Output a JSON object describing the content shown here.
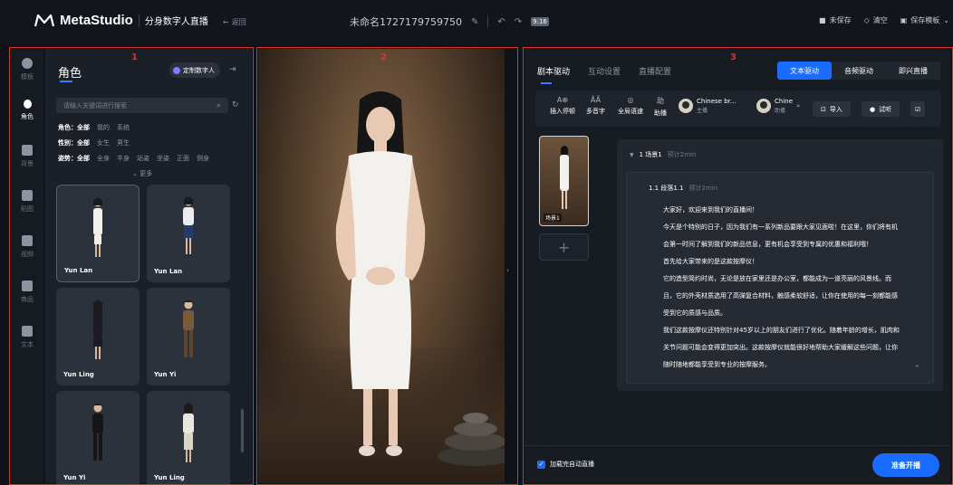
{
  "header": {
    "logo_text": "MetaStudio",
    "sub_title": "分身数字人直播",
    "back_label": "返回",
    "project_name": "未命名1727179759750",
    "ratio_badge": "9:16",
    "unsaved": "未保存",
    "clear": "清空",
    "save_template": "保存模板"
  },
  "panel_numbers": [
    "1",
    "2",
    "3"
  ],
  "rail": {
    "items": [
      {
        "label": "模板",
        "icon": "template-icon"
      },
      {
        "label": "角色",
        "icon": "person-icon"
      },
      {
        "label": "背景",
        "icon": "background-icon"
      },
      {
        "label": "贴图",
        "icon": "sticker-icon"
      },
      {
        "label": "视频",
        "icon": "video-icon"
      },
      {
        "label": "商品",
        "icon": "product-icon"
      },
      {
        "label": "文本",
        "icon": "text-icon"
      }
    ],
    "active_index": 1
  },
  "role_panel": {
    "title": "角色",
    "custom_btn": "定制数字人",
    "search_placeholder": "请输入关键词进行搜索",
    "filters": [
      {
        "label": "角色：",
        "options": [
          "全部",
          "我的",
          "系统"
        ]
      },
      {
        "label": "性别：",
        "options": [
          "全部",
          "女生",
          "男生"
        ]
      },
      {
        "label": "姿势：",
        "options": [
          "全部",
          "全身",
          "半身",
          "站姿",
          "坐姿",
          "正面",
          "侧身"
        ]
      }
    ],
    "more": "更多",
    "cards": [
      {
        "name": "Yun Lan",
        "outfit": "#f2efe9",
        "skirt": "#f2efe9"
      },
      {
        "name": "Yun Lan",
        "outfit": "#e9ecf2",
        "skirt": "#233c6b"
      },
      {
        "name": "Yun Ling",
        "outfit": "#1b1b24",
        "skirt": "#1b1b24"
      },
      {
        "name": "Yun Yi",
        "outfit": "#7a5a3a",
        "skirt": "#5c4630"
      },
      {
        "name": "Yun Yi",
        "outfit": "#161616",
        "skirt": "#161616"
      },
      {
        "name": "Yun Ling",
        "outfit": "#ebe6dc",
        "skirt": "#d9d3c6"
      }
    ]
  },
  "script_panel": {
    "tabs": [
      "剧本驱动",
      "互动设置",
      "直播配置"
    ],
    "drive_tabs": [
      "文本驱动",
      "音频驱动",
      "即兴直播"
    ],
    "tools": [
      {
        "glyph": "A⊕",
        "label": "插入停顿"
      },
      {
        "glyph": "ÃÃ",
        "label": "多音字"
      },
      {
        "glyph": "◎",
        "label": "全局语速"
      },
      {
        "glyph": "助",
        "label": "助播"
      }
    ],
    "voices": [
      {
        "name": "Chinese br...",
        "role": "主播"
      },
      {
        "name": "Chine",
        "role": "助播"
      }
    ],
    "import": "导入",
    "listen": "试听",
    "scene_thumb_label": "场景1",
    "scene_title": "1  场景1",
    "scene_estimate": "预计2min",
    "para_title": "1.1  段落1.1",
    "para_estimate": "预计2min",
    "lines": [
      "大家好，欢迎来到我们的直播间！",
      "今天是个特别的日子，因为我们有一系列新品要跟大家见面啦！在这里，你们将有机",
      "会第一时间了解到我们的新品信息，更有机会享受到专属的优惠和福利哦！",
      "首先给大家带来的是这款按摩仪！",
      "它的造型简约时尚，无论是放在家里还是办公室，都能成为一道亮丽的风景线。而",
      "且，它的外壳材质选用了高弹复合材料，触感柔软舒适，让你在使用的每一刻都能感",
      "受到它的质感与品质。",
      "我们这款按摩仪还特别针对45岁以上的朋友们进行了优化。随着年龄的增长，肌肉和",
      "关节问题可能会变得更加突出。这款按摩仪就能很好地帮助大家缓解这些问题，让你",
      "随时随地都能享受到专业的按摩服务。"
    ],
    "auto_live": "加载完自动直播",
    "start": "准备开播"
  }
}
